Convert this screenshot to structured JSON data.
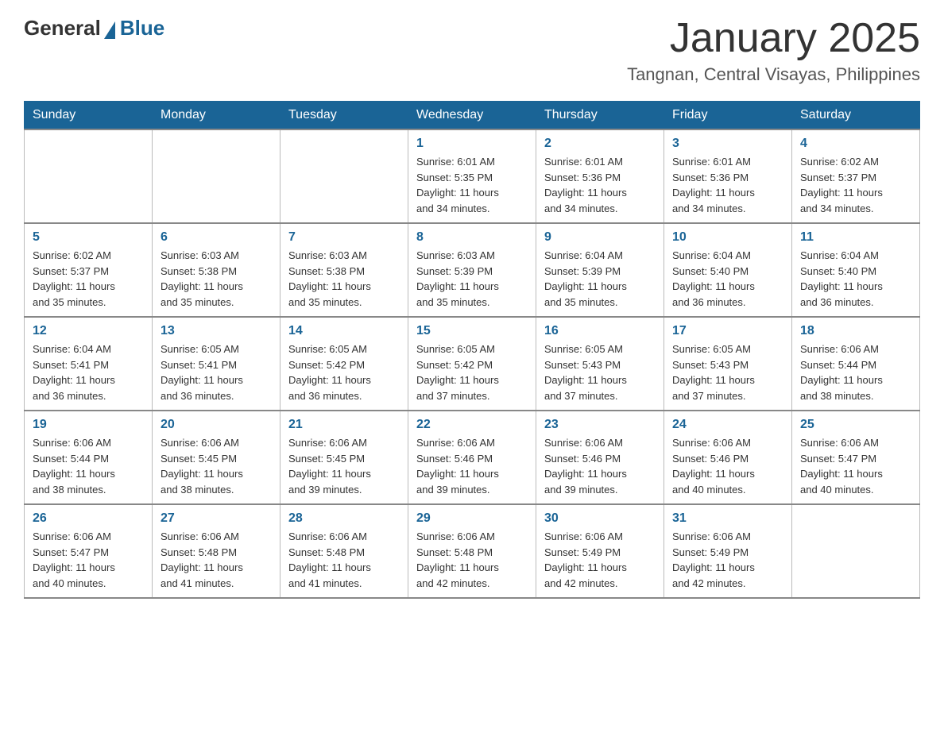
{
  "header": {
    "logo_general": "General",
    "logo_blue": "Blue",
    "month_title": "January 2025",
    "location": "Tangnan, Central Visayas, Philippines"
  },
  "days_of_week": [
    "Sunday",
    "Monday",
    "Tuesday",
    "Wednesday",
    "Thursday",
    "Friday",
    "Saturday"
  ],
  "weeks": [
    [
      {
        "day": "",
        "info": ""
      },
      {
        "day": "",
        "info": ""
      },
      {
        "day": "",
        "info": ""
      },
      {
        "day": "1",
        "info": "Sunrise: 6:01 AM\nSunset: 5:35 PM\nDaylight: 11 hours\nand 34 minutes."
      },
      {
        "day": "2",
        "info": "Sunrise: 6:01 AM\nSunset: 5:36 PM\nDaylight: 11 hours\nand 34 minutes."
      },
      {
        "day": "3",
        "info": "Sunrise: 6:01 AM\nSunset: 5:36 PM\nDaylight: 11 hours\nand 34 minutes."
      },
      {
        "day": "4",
        "info": "Sunrise: 6:02 AM\nSunset: 5:37 PM\nDaylight: 11 hours\nand 34 minutes."
      }
    ],
    [
      {
        "day": "5",
        "info": "Sunrise: 6:02 AM\nSunset: 5:37 PM\nDaylight: 11 hours\nand 35 minutes."
      },
      {
        "day": "6",
        "info": "Sunrise: 6:03 AM\nSunset: 5:38 PM\nDaylight: 11 hours\nand 35 minutes."
      },
      {
        "day": "7",
        "info": "Sunrise: 6:03 AM\nSunset: 5:38 PM\nDaylight: 11 hours\nand 35 minutes."
      },
      {
        "day": "8",
        "info": "Sunrise: 6:03 AM\nSunset: 5:39 PM\nDaylight: 11 hours\nand 35 minutes."
      },
      {
        "day": "9",
        "info": "Sunrise: 6:04 AM\nSunset: 5:39 PM\nDaylight: 11 hours\nand 35 minutes."
      },
      {
        "day": "10",
        "info": "Sunrise: 6:04 AM\nSunset: 5:40 PM\nDaylight: 11 hours\nand 36 minutes."
      },
      {
        "day": "11",
        "info": "Sunrise: 6:04 AM\nSunset: 5:40 PM\nDaylight: 11 hours\nand 36 minutes."
      }
    ],
    [
      {
        "day": "12",
        "info": "Sunrise: 6:04 AM\nSunset: 5:41 PM\nDaylight: 11 hours\nand 36 minutes."
      },
      {
        "day": "13",
        "info": "Sunrise: 6:05 AM\nSunset: 5:41 PM\nDaylight: 11 hours\nand 36 minutes."
      },
      {
        "day": "14",
        "info": "Sunrise: 6:05 AM\nSunset: 5:42 PM\nDaylight: 11 hours\nand 36 minutes."
      },
      {
        "day": "15",
        "info": "Sunrise: 6:05 AM\nSunset: 5:42 PM\nDaylight: 11 hours\nand 37 minutes."
      },
      {
        "day": "16",
        "info": "Sunrise: 6:05 AM\nSunset: 5:43 PM\nDaylight: 11 hours\nand 37 minutes."
      },
      {
        "day": "17",
        "info": "Sunrise: 6:05 AM\nSunset: 5:43 PM\nDaylight: 11 hours\nand 37 minutes."
      },
      {
        "day": "18",
        "info": "Sunrise: 6:06 AM\nSunset: 5:44 PM\nDaylight: 11 hours\nand 38 minutes."
      }
    ],
    [
      {
        "day": "19",
        "info": "Sunrise: 6:06 AM\nSunset: 5:44 PM\nDaylight: 11 hours\nand 38 minutes."
      },
      {
        "day": "20",
        "info": "Sunrise: 6:06 AM\nSunset: 5:45 PM\nDaylight: 11 hours\nand 38 minutes."
      },
      {
        "day": "21",
        "info": "Sunrise: 6:06 AM\nSunset: 5:45 PM\nDaylight: 11 hours\nand 39 minutes."
      },
      {
        "day": "22",
        "info": "Sunrise: 6:06 AM\nSunset: 5:46 PM\nDaylight: 11 hours\nand 39 minutes."
      },
      {
        "day": "23",
        "info": "Sunrise: 6:06 AM\nSunset: 5:46 PM\nDaylight: 11 hours\nand 39 minutes."
      },
      {
        "day": "24",
        "info": "Sunrise: 6:06 AM\nSunset: 5:46 PM\nDaylight: 11 hours\nand 40 minutes."
      },
      {
        "day": "25",
        "info": "Sunrise: 6:06 AM\nSunset: 5:47 PM\nDaylight: 11 hours\nand 40 minutes."
      }
    ],
    [
      {
        "day": "26",
        "info": "Sunrise: 6:06 AM\nSunset: 5:47 PM\nDaylight: 11 hours\nand 40 minutes."
      },
      {
        "day": "27",
        "info": "Sunrise: 6:06 AM\nSunset: 5:48 PM\nDaylight: 11 hours\nand 41 minutes."
      },
      {
        "day": "28",
        "info": "Sunrise: 6:06 AM\nSunset: 5:48 PM\nDaylight: 11 hours\nand 41 minutes."
      },
      {
        "day": "29",
        "info": "Sunrise: 6:06 AM\nSunset: 5:48 PM\nDaylight: 11 hours\nand 42 minutes."
      },
      {
        "day": "30",
        "info": "Sunrise: 6:06 AM\nSunset: 5:49 PM\nDaylight: 11 hours\nand 42 minutes."
      },
      {
        "day": "31",
        "info": "Sunrise: 6:06 AM\nSunset: 5:49 PM\nDaylight: 11 hours\nand 42 minutes."
      },
      {
        "day": "",
        "info": ""
      }
    ]
  ]
}
